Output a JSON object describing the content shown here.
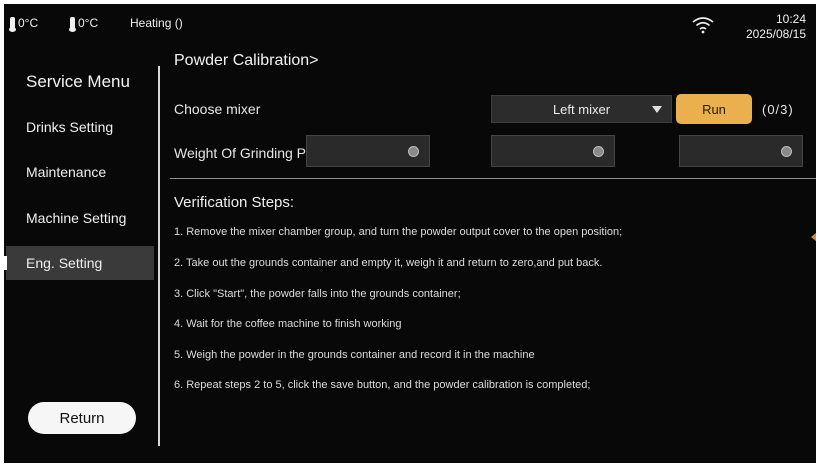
{
  "status_bar": {
    "temp1": "0°C",
    "temp2": "0°C",
    "mode": "Heating ()",
    "time": "10:24",
    "date": "2025/08/15",
    "icons": [
      "thermometer-icon",
      "thermometer-icon",
      "wifi-icon"
    ]
  },
  "sidebar": {
    "title": "Service Menu",
    "items": [
      {
        "label": "Drinks Setting",
        "active": false
      },
      {
        "label": "Maintenance",
        "active": false
      },
      {
        "label": "Machine Setting",
        "active": false
      },
      {
        "label": "Eng. Setting",
        "active": true
      }
    ],
    "return_label": "Return"
  },
  "main": {
    "breadcrumb": "Powder Calibration>",
    "choose_mixer_label": "Choose mixer",
    "mixer_selected": "Left mixer",
    "run_label": "Run",
    "run_count": "(0/3)",
    "weight_label": "Weight Of Grinding P",
    "weight_fields": [
      "",
      "",
      ""
    ],
    "steps_title": "Verification Steps:",
    "steps": [
      "1. Remove the mixer chamber group, and turn the powder output cover to the open position;",
      "2. Take out the grounds container and empty it, weigh it and return to zero,and put back.",
      "3. Click \"Start\", the powder falls into the grounds container;",
      "4. Wait for the coffee machine to finish working",
      "5. Weigh the powder in the grounds container and record it in the machine",
      "6. Repeat steps 2 to 5, click the save button, and the powder calibration is completed;"
    ]
  },
  "colors": {
    "background": "#080808",
    "accent": "#e9b04d",
    "active_item": "#3a3a3a",
    "field": "#2a2a2a"
  }
}
